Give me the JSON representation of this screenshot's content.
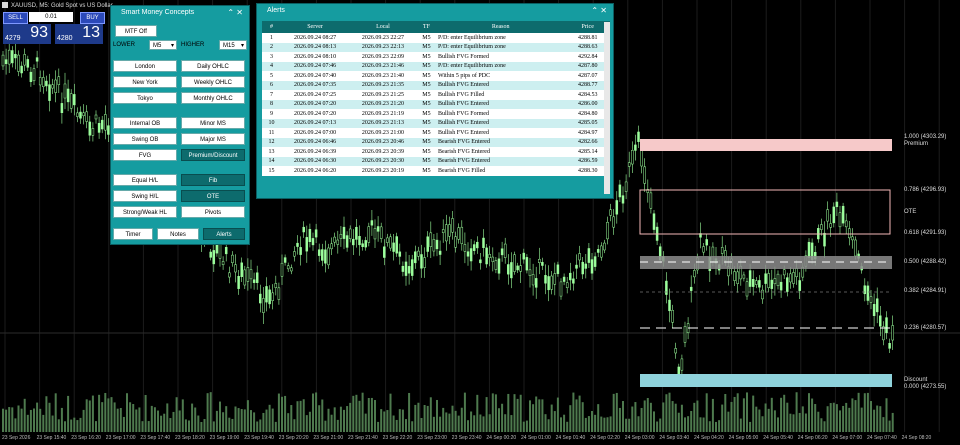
{
  "window": {
    "title": "XAUUSD, M5: Gold Spot vs US Dollar"
  },
  "trade": {
    "sell_label": "SELL",
    "buy_label": "BUY",
    "lot": "0.01",
    "sell_small": "4279",
    "sell_big": "93",
    "buy_small": "4280",
    "buy_big": "13"
  },
  "smc": {
    "title": "Smart Money Concepts",
    "mtf_label": "MTF Off",
    "lower_label": "LOWER",
    "lower_value": "M5",
    "higher_label": "HIGHER",
    "higher_value": "M15",
    "buttons": {
      "london": "London",
      "daily": "Daily OHLC",
      "newyork": "New York",
      "weekly": "Weekly OHLC",
      "tokyo": "Tokyo",
      "monthly": "Monthly OHLC",
      "internal_ob": "Internal OB",
      "minor_ms": "Minor MS",
      "swing_ob": "Swing OB",
      "major_ms": "Major MS",
      "fvg": "FVG",
      "premium": "Premium/Discount",
      "equal_hl": "Equal H/L",
      "fib": "Fib",
      "swing_hl": "Swing H/L",
      "ote": "OTE",
      "strong_weak": "Strong/Weak HL",
      "pivots": "Pivots",
      "timer": "Timer",
      "notes": "Notes",
      "alerts": "Alerts"
    }
  },
  "alerts": {
    "title": "Alerts",
    "columns": [
      "#",
      "Server",
      "Local",
      "TF",
      "Reason",
      "Price"
    ],
    "rows": [
      [
        "1",
        "2026.09.24 08:27",
        "2026.09.23 22:27",
        "M5",
        "P/D: enter Equilibrium zone",
        "4288.81"
      ],
      [
        "2",
        "2026.09.24 08:13",
        "2026.09.23 22:13",
        "M5",
        "P/D: enter Equilibrium zone",
        "4288.63"
      ],
      [
        "3",
        "2026.09.24 08:10",
        "2026.09.23 22:09",
        "M5",
        "Bullish FVG Formed",
        "4292.84"
      ],
      [
        "4",
        "2026.09.24 07:46",
        "2026.09.23 21:46",
        "M5",
        "P/D: enter Equilibrium zone",
        "4287.80"
      ],
      [
        "5",
        "2026.09.24 07:40",
        "2026.09.23 21:40",
        "M5",
        "Within 5 pips of PDC",
        "4287.07"
      ],
      [
        "6",
        "2026.09.24 07:35",
        "2026.09.23 21:35",
        "M5",
        "Bullish FVG Entered",
        "4288.77"
      ],
      [
        "7",
        "2026.09.24 07:25",
        "2026.09.23 21:25",
        "M5",
        "Bullish FVG Filled",
        "4284.53"
      ],
      [
        "8",
        "2026.09.24 07:20",
        "2026.09.23 21:20",
        "M5",
        "Bullish FVG Entered",
        "4286.00"
      ],
      [
        "9",
        "2026.09.24 07:20",
        "2026.09.23 21:19",
        "M5",
        "Bullish FVG Formed",
        "4284.80"
      ],
      [
        "10",
        "2026.09.24 07:13",
        "2026.09.23 21:13",
        "M5",
        "Bullish FVG Entered",
        "4285.05"
      ],
      [
        "11",
        "2026.09.24 07:00",
        "2026.09.23 21:00",
        "M5",
        "Bullish FVG Entered",
        "4284.97"
      ],
      [
        "12",
        "2026.09.24 06:46",
        "2026.09.23 20:46",
        "M5",
        "Bearish FVG Entered",
        "4282.66"
      ],
      [
        "13",
        "2026.09.24 06:39",
        "2026.09.23 20:39",
        "M5",
        "Bearish FVG Entered",
        "4285.14"
      ],
      [
        "14",
        "2026.09.24 06:30",
        "2026.09.23 20:30",
        "M5",
        "Bearish FVG Entered",
        "4286.59"
      ],
      [
        "15",
        "2026.09.24 06:20",
        "2026.09.23 20:19",
        "M5",
        "Bearish FVG Filled",
        "4288.30"
      ]
    ]
  },
  "levels": {
    "premium_price": "1.000 (4303.29)",
    "premium_label": "Premium",
    "ote_price": "0.786 (4296.93)",
    "ote_label": "OTE",
    "l618": "0.618 (4291.93)",
    "l500": "0.500 (4288.42)",
    "l382": "0.382 (4284.91)",
    "l236": "0.236 (4280.57)",
    "discount_label": "Discount",
    "l000": "0.000 (4273.55)"
  },
  "dates": [
    "23 Sep 2026",
    "23 Sep 15:40",
    "23 Sep 16:20",
    "23 Sep 17:00",
    "23 Sep 17:40",
    "23 Sep 18:20",
    "23 Sep 19:00",
    "23 Sep 19:40",
    "23 Sep 20:20",
    "23 Sep 21:00",
    "23 Sep 21:40",
    "23 Sep 22:20",
    "23 Sep 23:00",
    "23 Sep 23:40",
    "24 Sep 00:20",
    "24 Sep 01:00",
    "24 Sep 01:40",
    "24 Sep 02:20",
    "24 Sep 03:00",
    "24 Sep 03:40",
    "24 Sep 04:20",
    "24 Sep 05:00",
    "24 Sep 05:40",
    "24 Sep 06:20",
    "24 Sep 07:00",
    "24 Sep 07:40",
    "24 Sep 08:20"
  ],
  "colors": {
    "bull": "#9dff9d",
    "premium": "#f6c9c9",
    "discount": "#8fd3dc",
    "ote": "#f4b7b7",
    "eq": "#8c8c8c"
  }
}
